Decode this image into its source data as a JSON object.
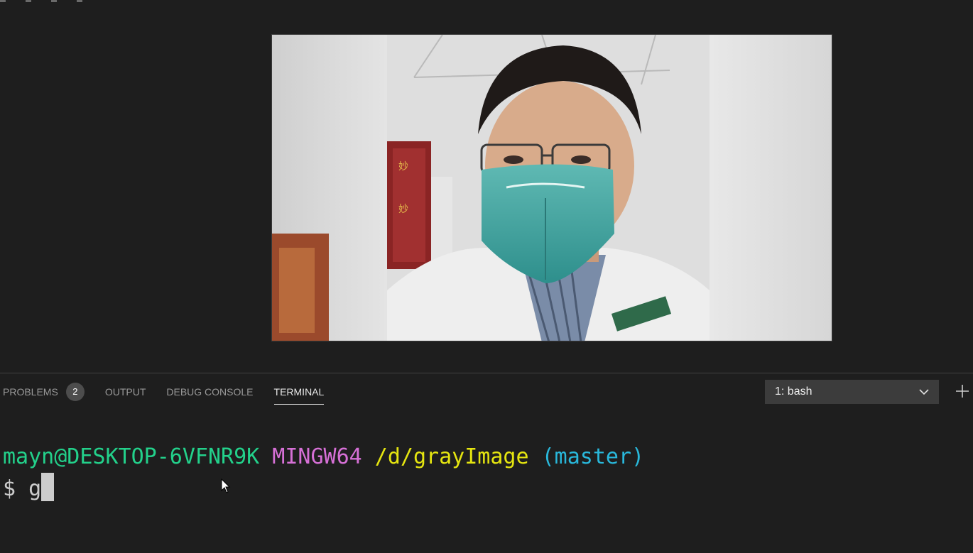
{
  "panel": {
    "tabs": [
      {
        "label": "PROBLEMS",
        "badge": "2"
      },
      {
        "label": "OUTPUT"
      },
      {
        "label": "DEBUG CONSOLE"
      },
      {
        "label": "TERMINAL",
        "active": true
      }
    ],
    "terminal_selector": {
      "value": "1: bash"
    }
  },
  "terminal": {
    "prompt": {
      "user_host": "mayn@DESKTOP-6VFNR9K",
      "system": "MINGW64",
      "path": "/d/grayImage",
      "branch": "(master)"
    },
    "input_line": {
      "symbol": "$",
      "typed": "g"
    }
  },
  "icons": {
    "selector_chevron": "chevron-down-icon",
    "new_terminal": "plus-icon",
    "mouse": "mouse-pointer-icon"
  },
  "colors": {
    "background": "#1e1e1e",
    "user_host": "#23d18b",
    "system": "#d670d6",
    "path": "#e5e510",
    "branch": "#29b8db"
  }
}
